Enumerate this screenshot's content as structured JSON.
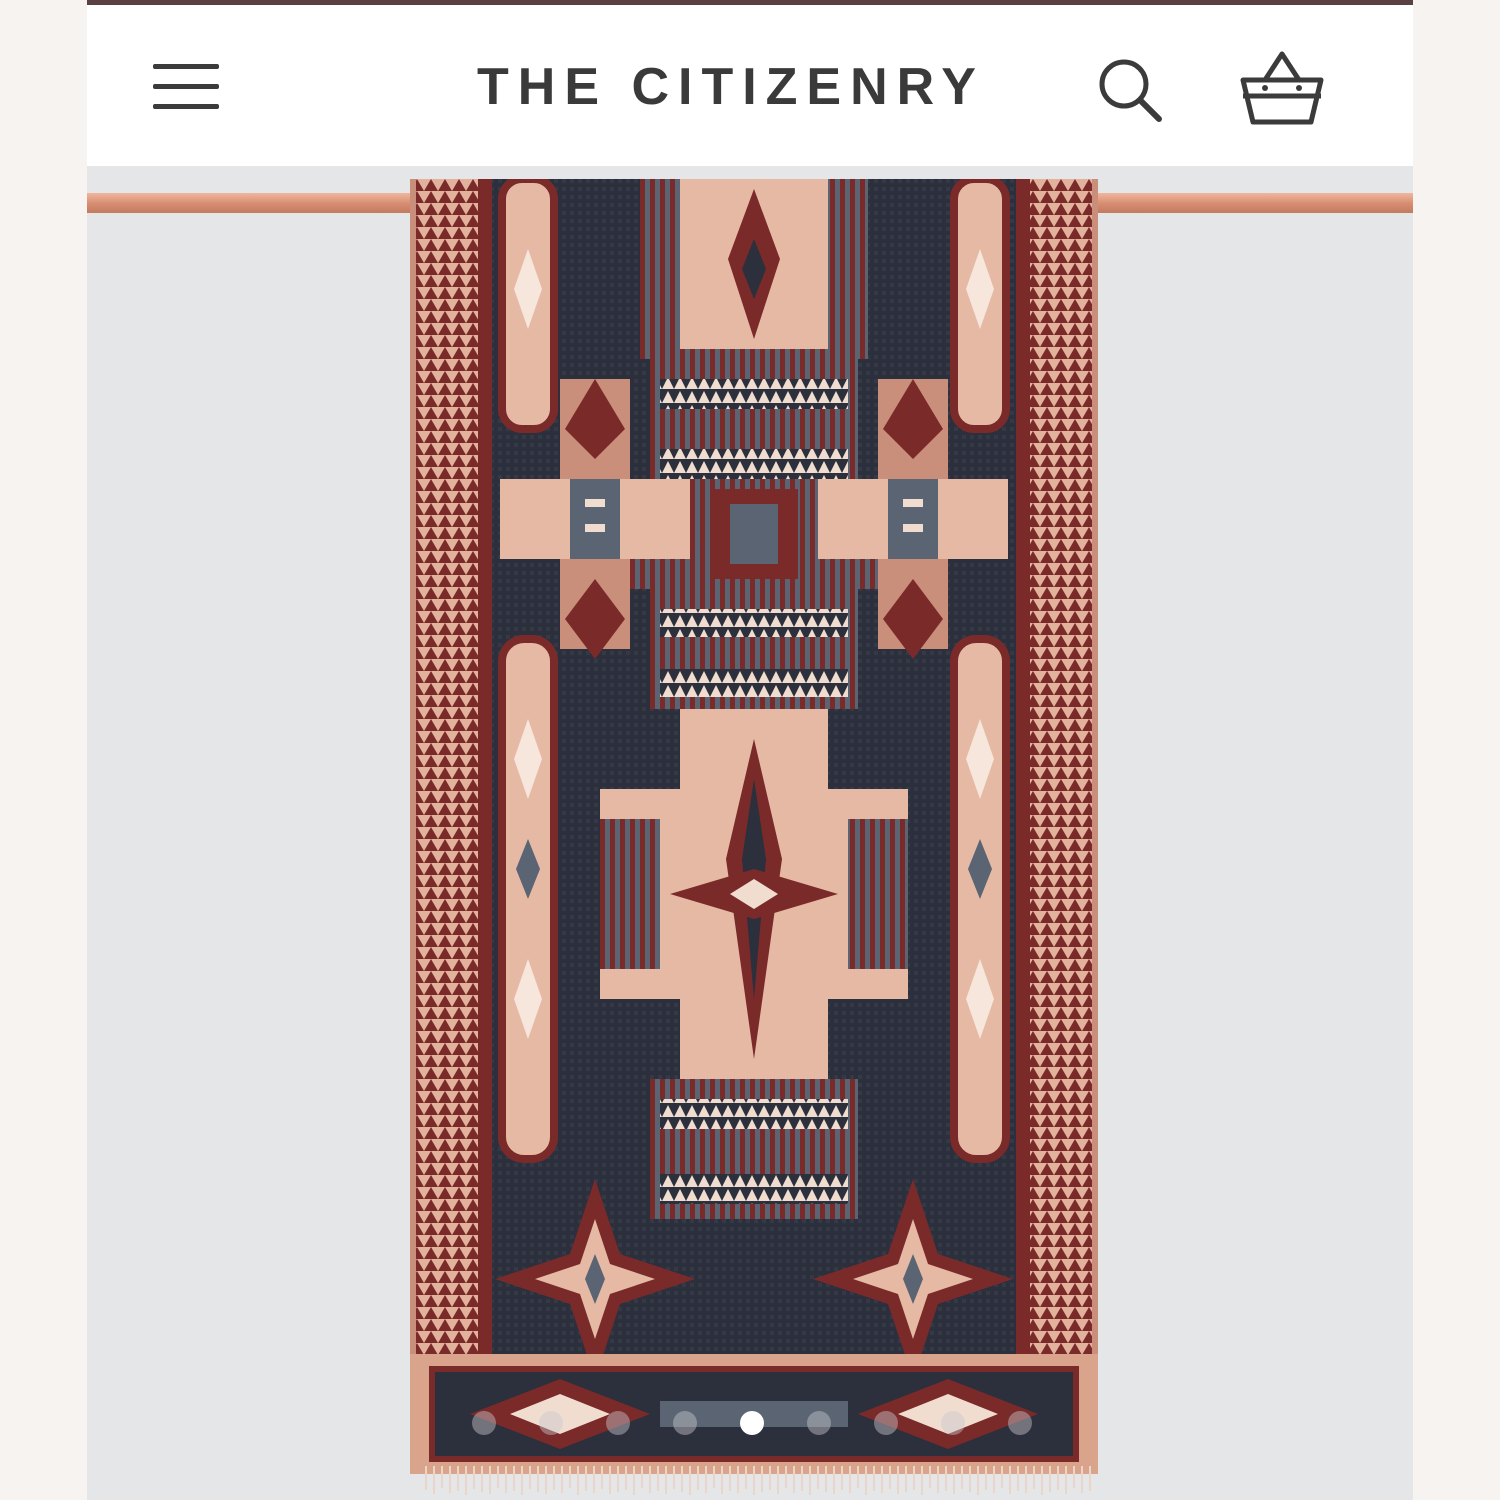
{
  "header": {
    "brand": "THE CITIZENRY"
  },
  "icons": {
    "menu": "hamburger-menu-icon",
    "search": "search-icon",
    "cart": "shopping-basket-icon"
  },
  "carousel": {
    "slide_count": 9,
    "active_index": 4
  },
  "colors": {
    "top_stripe": "#5a3f43",
    "header_bg": "#ffffff",
    "backdrop": "#e4e6e8",
    "rod": "#d58c70",
    "rug_navy": "#2c2f3c",
    "rug_maroon": "#7b2a2a",
    "rug_blush": "#e6b9a4",
    "rug_cream": "#f1ddd0",
    "rug_slate": "#5a6472"
  }
}
